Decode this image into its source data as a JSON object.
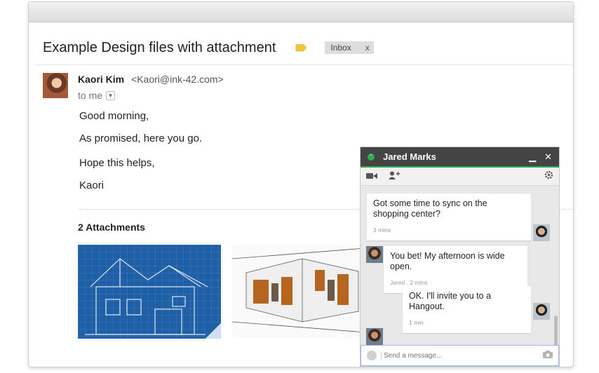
{
  "email": {
    "subject": "Example Design files with attachment",
    "label_chip": {
      "text": "Inbox",
      "close": "x"
    },
    "sender": {
      "name": "Kaori Kim",
      "email": "<Kaori@ink-42.com>"
    },
    "recipient_line": "to me",
    "body_lines": [
      "Good morning,",
      "As promised, here you go.",
      "Hope this helps,",
      "Kaori"
    ],
    "attachments_heading": "2 Attachments",
    "label_color": "#f2c343"
  },
  "chat": {
    "contact_name": "Jared Marks",
    "status_color": "#2cae4c",
    "messages": [
      {
        "text": "Got some time to sync on the shopping center?",
        "meta": "3 mins",
        "from": "me"
      },
      {
        "text": "You bet! My afternoon is wide open.",
        "meta": "Jared . 2 mins",
        "from": "contact"
      },
      {
        "text": "OK. I'll invite you to a Hangout.",
        "meta": "1 min",
        "from": "me"
      }
    ],
    "input_placeholder": "Send a message...",
    "icons": [
      "minimize-icon",
      "close-icon",
      "video-icon",
      "add-person-icon",
      "gear-icon",
      "emoji-icon",
      "camera-icon"
    ]
  }
}
